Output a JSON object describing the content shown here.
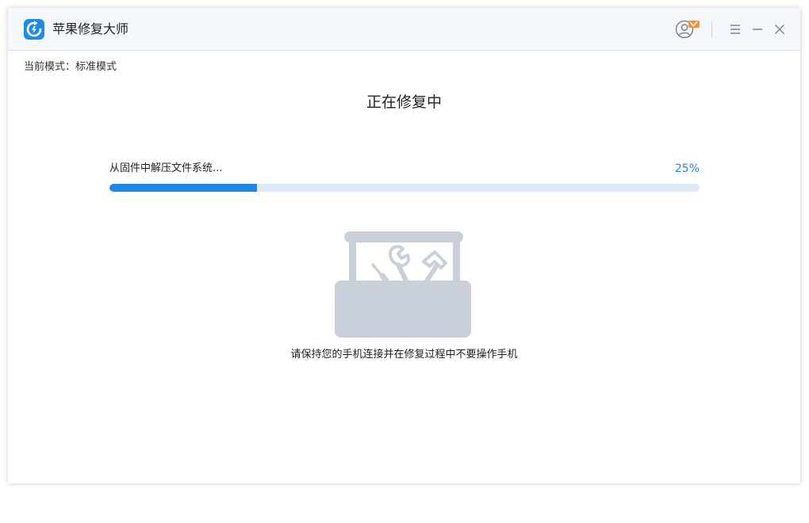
{
  "app": {
    "title": "苹果修复大师",
    "icons": {
      "logo": "app-logo-icon",
      "user": "user-avatar-icon",
      "vip_badge": "vip-badge-icon",
      "menu": "hamburger-menu-icon",
      "minimize": "minimize-icon",
      "close": "close-icon"
    }
  },
  "mode": {
    "text": "当前模式：标准模式"
  },
  "repair": {
    "title": "正在修复中",
    "status": "从固件中解压文件系统...",
    "percent_label": "25%",
    "progress": 0.25,
    "illustration": "toolbox-illustration",
    "hint": "请保持您的手机连接并在修复过程中不要操作手机"
  },
  "colors": {
    "accent": "#1e88e5",
    "track": "#dceaf8",
    "titlebar_bg": "#f4f8fc",
    "illustration_gray": "#c9d0da",
    "vip_orange": "#f5913a"
  }
}
